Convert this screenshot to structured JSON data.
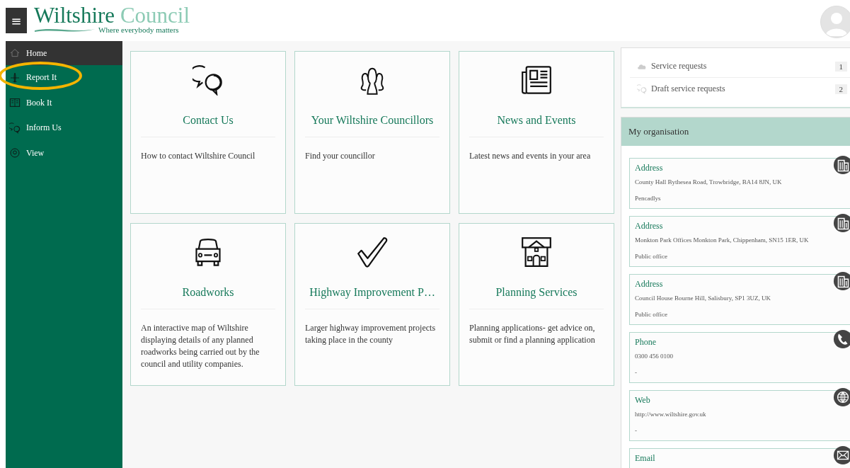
{
  "header": {
    "menu_button": "≡",
    "logo": {
      "primary": "Wiltshire",
      "secondary": "Council",
      "tagline": "Where everybody matters"
    }
  },
  "sidebar": {
    "items": [
      {
        "label": "Home",
        "kind": "home",
        "selected": true,
        "highlighted": false
      },
      {
        "label": "Report It",
        "kind": "plane",
        "selected": false,
        "highlighted": true
      },
      {
        "label": "Book It",
        "kind": "book",
        "selected": false,
        "highlighted": false
      },
      {
        "label": "Inform Us",
        "kind": "chat",
        "selected": false,
        "highlighted": false
      },
      {
        "label": "View",
        "kind": "eye",
        "selected": false,
        "highlighted": false
      }
    ]
  },
  "tiles": [
    {
      "kind": "chat",
      "title": "Contact Us",
      "description": "How to contact Wiltshire Council"
    },
    {
      "kind": "people",
      "title": "Your Wiltshire Councillors",
      "description": "Find your councillor"
    },
    {
      "kind": "newspaper",
      "title": "News and Events",
      "description": "Latest news and events in your area"
    },
    {
      "kind": "car",
      "title": "Roadworks",
      "description": "An interactive map of Wiltshire displaying details of any planned roadworks being carried out by the council and utility companies."
    },
    {
      "kind": "check",
      "title": "Highway Improvement P…",
      "description": "Larger highway improvement projects taking place in the county"
    },
    {
      "kind": "house",
      "title": "Planning Services",
      "description": "Planning applications- get advice on, submit or find a planning application"
    }
  ],
  "requests": [
    {
      "kind": "cloud",
      "label": "Service requests",
      "count": "1"
    },
    {
      "kind": "chat",
      "label": "Draft service requests",
      "count": "2"
    }
  ],
  "organisation": {
    "title": "My organisation",
    "contacts": [
      {
        "kind": "building",
        "title": "Address",
        "lines": [
          "County Hall Bythesea Road, Trowbridge, BA14 8JN, UK",
          "Pencadlys"
        ]
      },
      {
        "kind": "building",
        "title": "Address",
        "lines": [
          "Monkton Park Offices Monkton Park, Chippenham, SN15 1ER, UK",
          "Public office"
        ]
      },
      {
        "kind": "building",
        "title": "Address",
        "lines": [
          "Council House Bourne Hill, Salisbury, SP1 3UZ, UK",
          "Public office"
        ]
      },
      {
        "kind": "phone",
        "title": "Phone",
        "lines": [
          "0300 456 0100",
          "-"
        ]
      },
      {
        "kind": "globe",
        "title": "Web",
        "lines": [
          "http://www.wiltshire.gov.uk",
          "-"
        ]
      },
      {
        "kind": "mail",
        "title": "Email"
      }
    ]
  }
}
